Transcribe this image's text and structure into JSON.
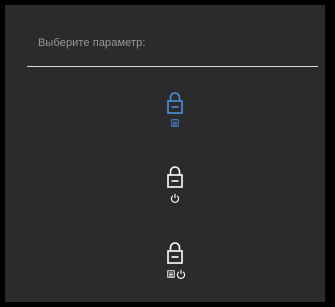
{
  "prompt": "Выберите параметр:",
  "colors": {
    "selected": "#4a8fdf",
    "normal": "#ffffff",
    "background": "#2b2b2b",
    "divider": "#d8d8d8",
    "prompt_text": "#9a9a9a"
  },
  "options": [
    {
      "name": "lock-menu",
      "icons": [
        "lock-icon",
        "menu-icon"
      ],
      "selected": true
    },
    {
      "name": "lock-power",
      "icons": [
        "lock-icon",
        "power-icon"
      ],
      "selected": false
    },
    {
      "name": "lock-menu-power",
      "icons": [
        "lock-icon",
        "menu-icon",
        "power-icon"
      ],
      "selected": false
    }
  ]
}
